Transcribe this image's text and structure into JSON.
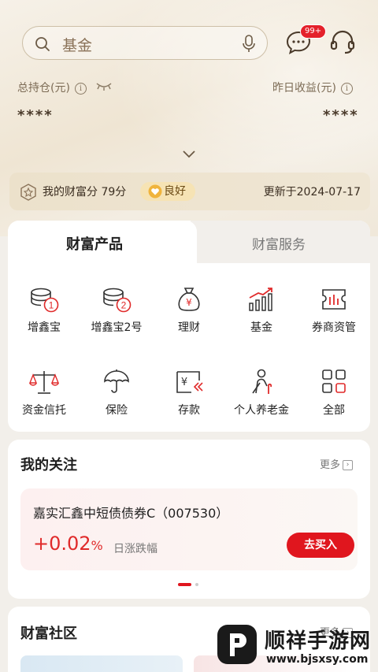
{
  "search": {
    "placeholder_text": "基金"
  },
  "header": {
    "message_badge": "99+"
  },
  "assets": {
    "total_label": "总持仓(元)",
    "total_value": "****",
    "yesterday_label": "昨日收益(元)",
    "yesterday_value": "****",
    "info_mark": "i"
  },
  "score": {
    "label": "我的财富分 79分",
    "status": "良好",
    "updated": "更新于2024-07-17"
  },
  "tabs": {
    "products": "财富产品",
    "services": "财富服务"
  },
  "products": [
    {
      "label": "增鑫宝",
      "icon": "coins-1-icon"
    },
    {
      "label": "增鑫宝2号",
      "icon": "coins-2-icon"
    },
    {
      "label": "理财",
      "icon": "money-bag-icon"
    },
    {
      "label": "基金",
      "icon": "bar-trend-icon"
    },
    {
      "label": "券商资管",
      "icon": "ticket-chart-icon"
    },
    {
      "label": "资金信托",
      "icon": "balance-scale-icon"
    },
    {
      "label": "保险",
      "icon": "umbrella-icon"
    },
    {
      "label": "存款",
      "icon": "deposit-icon"
    },
    {
      "label": "个人养老金",
      "icon": "elder-icon"
    },
    {
      "label": "全部",
      "icon": "grid-icon"
    }
  ],
  "follow": {
    "title": "我的关注",
    "more": "更多",
    "fund_name": "嘉实汇鑫中短债债券C（007530）",
    "change_value": "+0.02",
    "change_unit": "%",
    "change_label": "日涨跌幅",
    "buy_label": "去买入"
  },
  "community": {
    "title": "财富社区",
    "more": "更多"
  },
  "watermark": {
    "title": "顺祥手游网",
    "url": "www.bjsxsy.com"
  },
  "colors": {
    "accent": "#e0161e",
    "gold": "#8a7258",
    "bg": "#f2efea"
  }
}
